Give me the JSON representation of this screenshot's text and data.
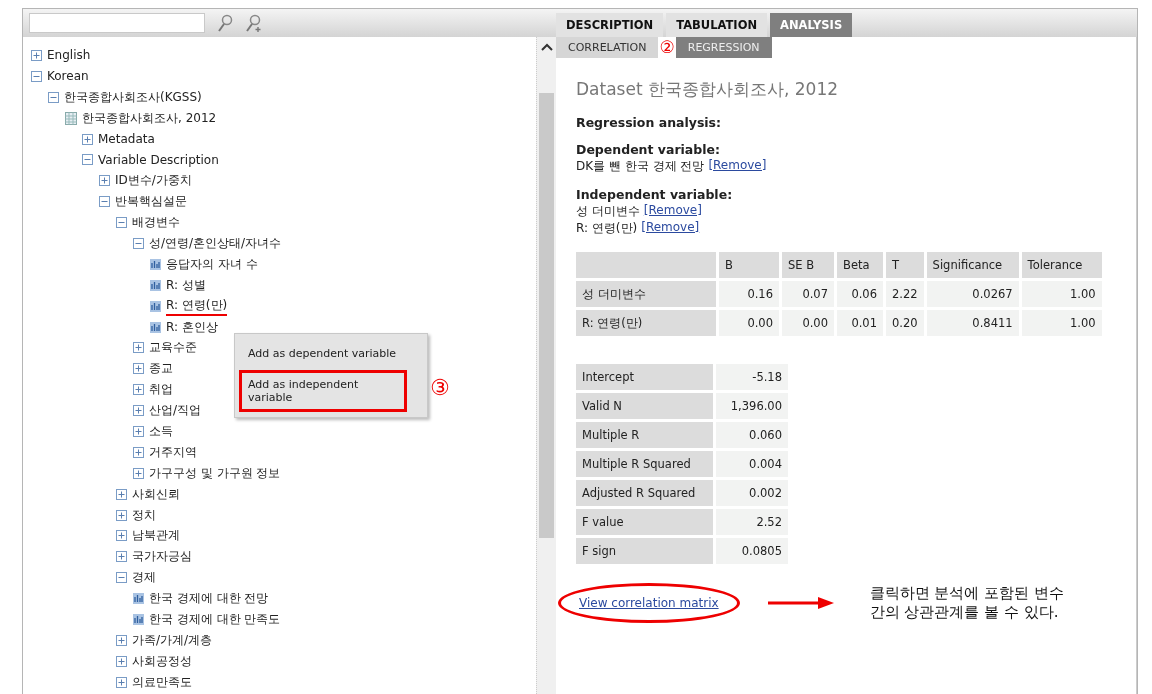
{
  "tree": [
    {
      "label": "English",
      "kind": "group",
      "expanded": false
    },
    {
      "label": "Korean",
      "kind": "group",
      "expanded": true,
      "children": [
        {
          "label": "한국종합사회조사(KGSS)",
          "kind": "group",
          "expanded": true,
          "children": [
            {
              "label": "한국종합사회조사, 2012",
              "kind": "dataset",
              "children": [
                {
                  "label": "Metadata",
                  "kind": "group",
                  "expanded": false
                },
                {
                  "label": "Variable Description",
                  "kind": "group",
                  "expanded": true,
                  "children": [
                    {
                      "label": "ID변수/가중치",
                      "kind": "group",
                      "expanded": false
                    },
                    {
                      "label": "반복핵심설문",
                      "kind": "group",
                      "expanded": true,
                      "children": [
                        {
                          "label": "배경변수",
                          "kind": "group",
                          "expanded": true,
                          "children": [
                            {
                              "label": "성/연령/혼인상태/자녀수",
                              "kind": "group",
                              "expanded": true,
                              "children": [
                                {
                                  "label": "응답자의 자녀 수",
                                  "kind": "variable",
                                  "marked": false
                                },
                                {
                                  "label": "R: 성별",
                                  "kind": "variable",
                                  "marked": false
                                },
                                {
                                  "label": "R: 연령(만)",
                                  "kind": "variable",
                                  "marked": true
                                },
                                {
                                  "label": "R: 혼인상",
                                  "kind": "variable",
                                  "marked": false
                                }
                              ]
                            },
                            {
                              "label": "교육수준",
                              "kind": "group",
                              "expanded": false
                            },
                            {
                              "label": "종교",
                              "kind": "group",
                              "expanded": false
                            },
                            {
                              "label": "취업",
                              "kind": "group",
                              "expanded": false
                            },
                            {
                              "label": "산업/직업",
                              "kind": "group",
                              "expanded": false
                            },
                            {
                              "label": "소득",
                              "kind": "group",
                              "expanded": false
                            },
                            {
                              "label": "거주지역",
                              "kind": "group",
                              "expanded": false
                            },
                            {
                              "label": "가구구성 및 가구원 정보",
                              "kind": "group",
                              "expanded": false
                            }
                          ]
                        },
                        {
                          "label": "사회신뢰",
                          "kind": "group",
                          "expanded": false
                        },
                        {
                          "label": "정치",
                          "kind": "group",
                          "expanded": false
                        },
                        {
                          "label": "남북관계",
                          "kind": "group",
                          "expanded": false
                        },
                        {
                          "label": "국가자긍심",
                          "kind": "group",
                          "expanded": false
                        },
                        {
                          "label": "경제",
                          "kind": "group",
                          "expanded": true,
                          "children": [
                            {
                              "label": "한국 경제에 대한 전망",
                              "kind": "variable",
                              "marked": false
                            },
                            {
                              "label": "한국 경제에 대한 만족도",
                              "kind": "variable",
                              "marked": false
                            }
                          ]
                        },
                        {
                          "label": "가족/가계/계층",
                          "kind": "group",
                          "expanded": false
                        },
                        {
                          "label": "사회공정성",
                          "kind": "group",
                          "expanded": false
                        },
                        {
                          "label": "의료만족도",
                          "kind": "group",
                          "expanded": false
                        }
                      ]
                    }
                  ]
                }
              ]
            }
          ]
        }
      ]
    }
  ],
  "context_menu": {
    "items": [
      {
        "label": "Add as dependent variable",
        "marked": false
      },
      {
        "label": "Add as independent variable",
        "marked": true
      }
    ],
    "callout": "③"
  },
  "tabs": [
    {
      "label": "DESCRIPTION",
      "selected": false
    },
    {
      "label": "TABULATION",
      "selected": false
    },
    {
      "label": "ANALYSIS",
      "selected": true
    }
  ],
  "subtabs": [
    {
      "label": "CORRELATION",
      "selected": false
    },
    {
      "label": "REGRESSION",
      "selected": true
    }
  ],
  "subtabs_callout": "②",
  "dataset_title": "Dataset 한국종합사회조사, 2012",
  "analysis_heading": "Regression analysis:",
  "dependent": {
    "heading": "Dependent variable:",
    "items": [
      {
        "name": "DK를 뺀 한국 경제 전망",
        "action": "[Remove]"
      }
    ]
  },
  "independent": {
    "heading": "Independent variable:",
    "items": [
      {
        "name": "성 더미변수",
        "action": "[Remove]"
      },
      {
        "name": "R: 연령(만)",
        "action": "[Remove]"
      }
    ]
  },
  "coefficients": {
    "columns": [
      "",
      "B",
      "SE B",
      "Beta",
      "T",
      "Significance",
      "Tolerance"
    ],
    "rows": [
      [
        "성 더미변수",
        "0.16",
        "0.07",
        "0.06",
        "2.22",
        "0.0267",
        "1.00"
      ],
      [
        "R: 연령(만)",
        "0.00",
        "0.00",
        "0.01",
        "0.20",
        "0.8411",
        "1.00"
      ]
    ]
  },
  "statistics": [
    {
      "label": "Intercept",
      "value": "-5.18"
    },
    {
      "label": "Valid N",
      "value": "1,396.00"
    },
    {
      "label": "Multiple R",
      "value": "0.060"
    },
    {
      "label": "Multiple R Squared",
      "value": "0.004"
    },
    {
      "label": "Adjusted R Squared",
      "value": "0.002"
    },
    {
      "label": "F value",
      "value": "2.52"
    },
    {
      "label": "F sign",
      "value": "0.0805"
    }
  ],
  "correlation_link": {
    "label": "View correlation matrix",
    "circled": true
  },
  "note": "클릭하면 분석에 포함된 변수\n간의 상관관계를 볼 수 있다."
}
